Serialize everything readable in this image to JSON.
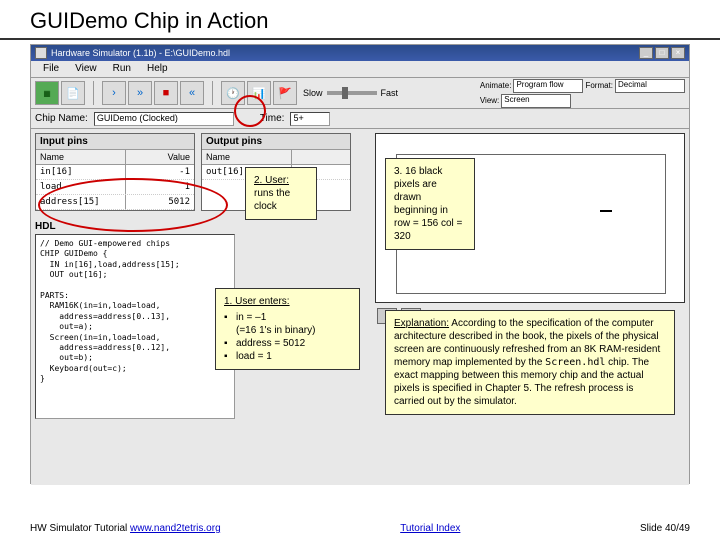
{
  "slide": {
    "title": "GUIDemo Chip in Action"
  },
  "window": {
    "title": "Hardware Simulator (1.1b) - E:\\GUIDemo.hdl"
  },
  "menu": {
    "file": "File",
    "view": "View",
    "run": "Run",
    "help": "Help"
  },
  "toolbar": {
    "slow": "Slow",
    "fast": "Fast",
    "animate": "Animate:",
    "animate_value": "Program flow",
    "format": "Format:",
    "format_value": "Decimal",
    "view": "View:",
    "view_value": "Screen"
  },
  "chip": {
    "label": "Chip Name:",
    "value": "GUIDemo (Clocked)",
    "time_label": "Time:",
    "time_value": "5+"
  },
  "input_pins": {
    "header": "Input pins",
    "cols": {
      "name": "Name",
      "value": "Value"
    },
    "rows": [
      {
        "name": "in[16]",
        "value": "-1"
      },
      {
        "name": "load",
        "value": "1"
      },
      {
        "name": "address[15]",
        "value": "5012"
      }
    ]
  },
  "output_pins": {
    "header": "Output pins",
    "cols": {
      "name": "Name",
      "value": ""
    },
    "rows": [
      {
        "name": "out[16]",
        "value": ""
      }
    ]
  },
  "hdl": {
    "label": "HDL",
    "text": "// Demo GUI-empowered chips\nCHIP GUIDemo {\n  IN in[16],load,address[15];\n  OUT out[16];\n\nPARTS:\n  RAM16K(in=in,load=load,\n    address=address[0..13],\n    out=a);\n  Screen(in=in,load=load,\n    address=address[0..12],\n    out=b);\n  Keyboard(out=c);\n}"
  },
  "callouts": {
    "c2": {
      "label": "2. User:",
      "text": "runs the clock"
    },
    "c3": {
      "label": "3.",
      "text": "16 black pixels are drawn beginning in row = 156 col = 320"
    },
    "c1": {
      "label": "1. User enters:",
      "b1": "in = –1",
      "b1_sub": "(=16 1's in binary)",
      "b2": "address = 5012",
      "b3": "load = 1"
    },
    "explain": {
      "label": "Explanation:",
      "text": "According to the specification of the computer architecture described in the book, the pixels of the physical screen are continuously refreshed from an 8K RAM-resident memory map implemented by the ",
      "code": "Screen.hdl",
      "text2": " chip. The exact mapping between this memory chip and the actual pixels is specified in Chapter 5. The refresh process is carried out by the simulator."
    }
  },
  "footer": {
    "left_text": "HW Simulator Tutorial ",
    "left_link": "www.nand2tetris.org",
    "center_link": "Tutorial Index",
    "right_text": "Slide 40/49"
  }
}
